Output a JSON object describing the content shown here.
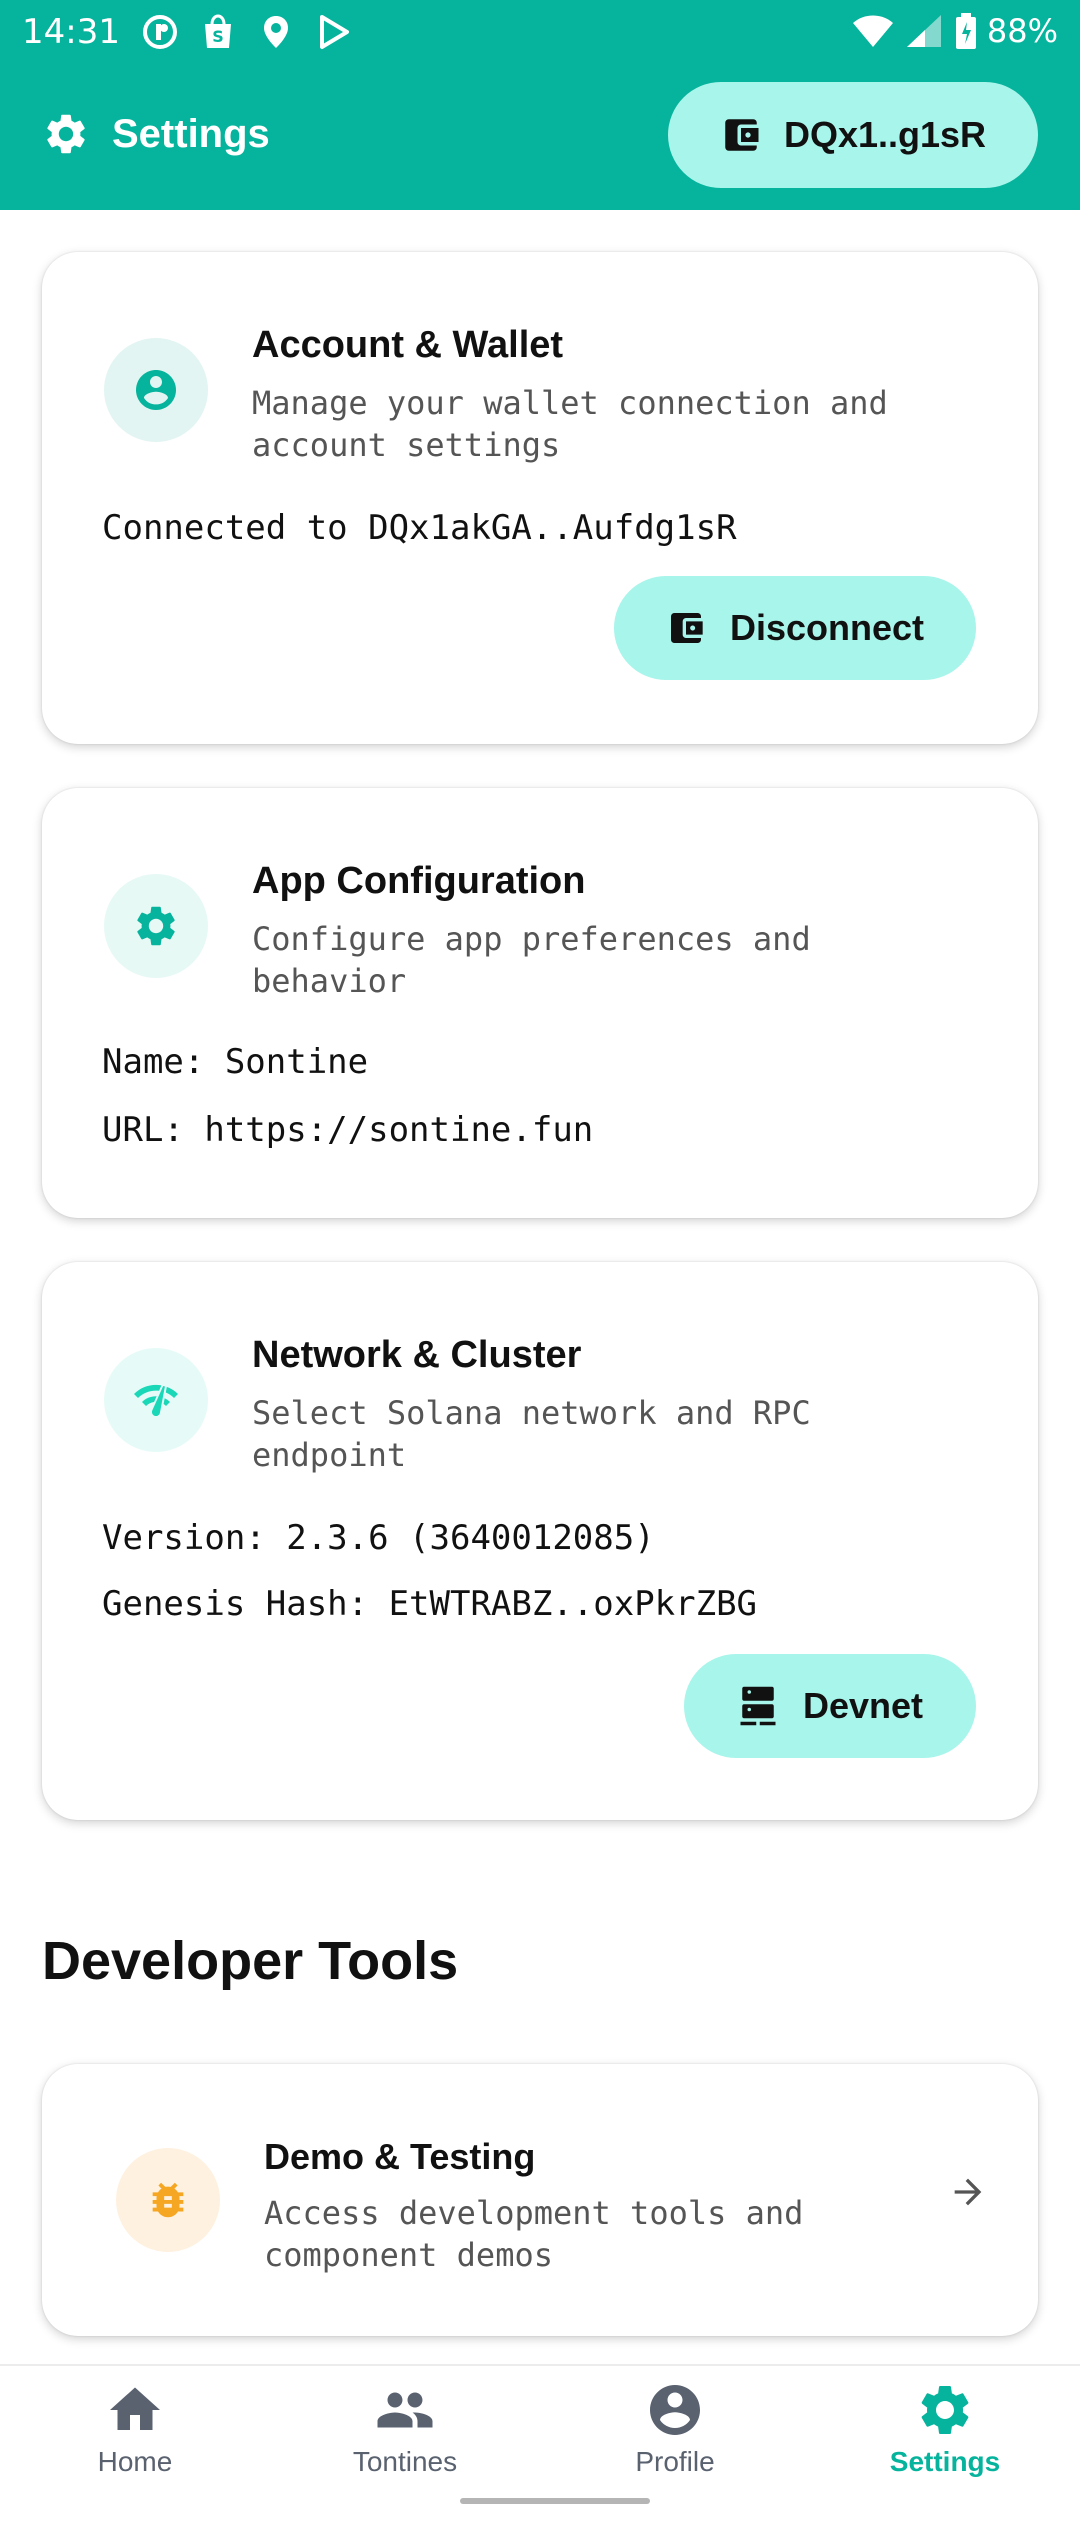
{
  "status_bar": {
    "time": "14:31",
    "battery": "88%"
  },
  "app_bar": {
    "title": "Settings",
    "wallet_label": "DQx1..g1sR"
  },
  "account_card": {
    "title": "Account & Wallet",
    "subtitle": "Manage your wallet connection and account settings",
    "connected_text": "Connected to DQx1akGA..Aufdg1sR",
    "disconnect_label": "Disconnect"
  },
  "app_config_card": {
    "title": "App Configuration",
    "subtitle": "Configure app preferences and behavior",
    "name_line": "Name: Sontine",
    "url_line": "URL: https://sontine.fun"
  },
  "network_card": {
    "title": "Network & Cluster",
    "subtitle": "Select Solana network and RPC endpoint",
    "version_line": "Version: 2.3.6 (3640012085)",
    "genesis_line": "Genesis Hash: EtWTRABZ..oxPkrZBG",
    "cluster_label": "Devnet"
  },
  "developer_tools": {
    "section_title": "Developer Tools",
    "demo_card": {
      "title": "Demo & Testing",
      "subtitle": "Access development tools and component demos"
    }
  },
  "bottom_nav": {
    "items": [
      {
        "label": "Home",
        "icon": "home-icon"
      },
      {
        "label": "Tontines",
        "icon": "people-icon"
      },
      {
        "label": "Profile",
        "icon": "account-circle-icon"
      },
      {
        "label": "Settings",
        "icon": "gear-icon",
        "active": true
      }
    ]
  },
  "colors": {
    "primary": "#06b39c",
    "pill": "#a8f5eb",
    "demo_icon_bg": "#fff1e0",
    "demo_icon": "#f5a623"
  }
}
